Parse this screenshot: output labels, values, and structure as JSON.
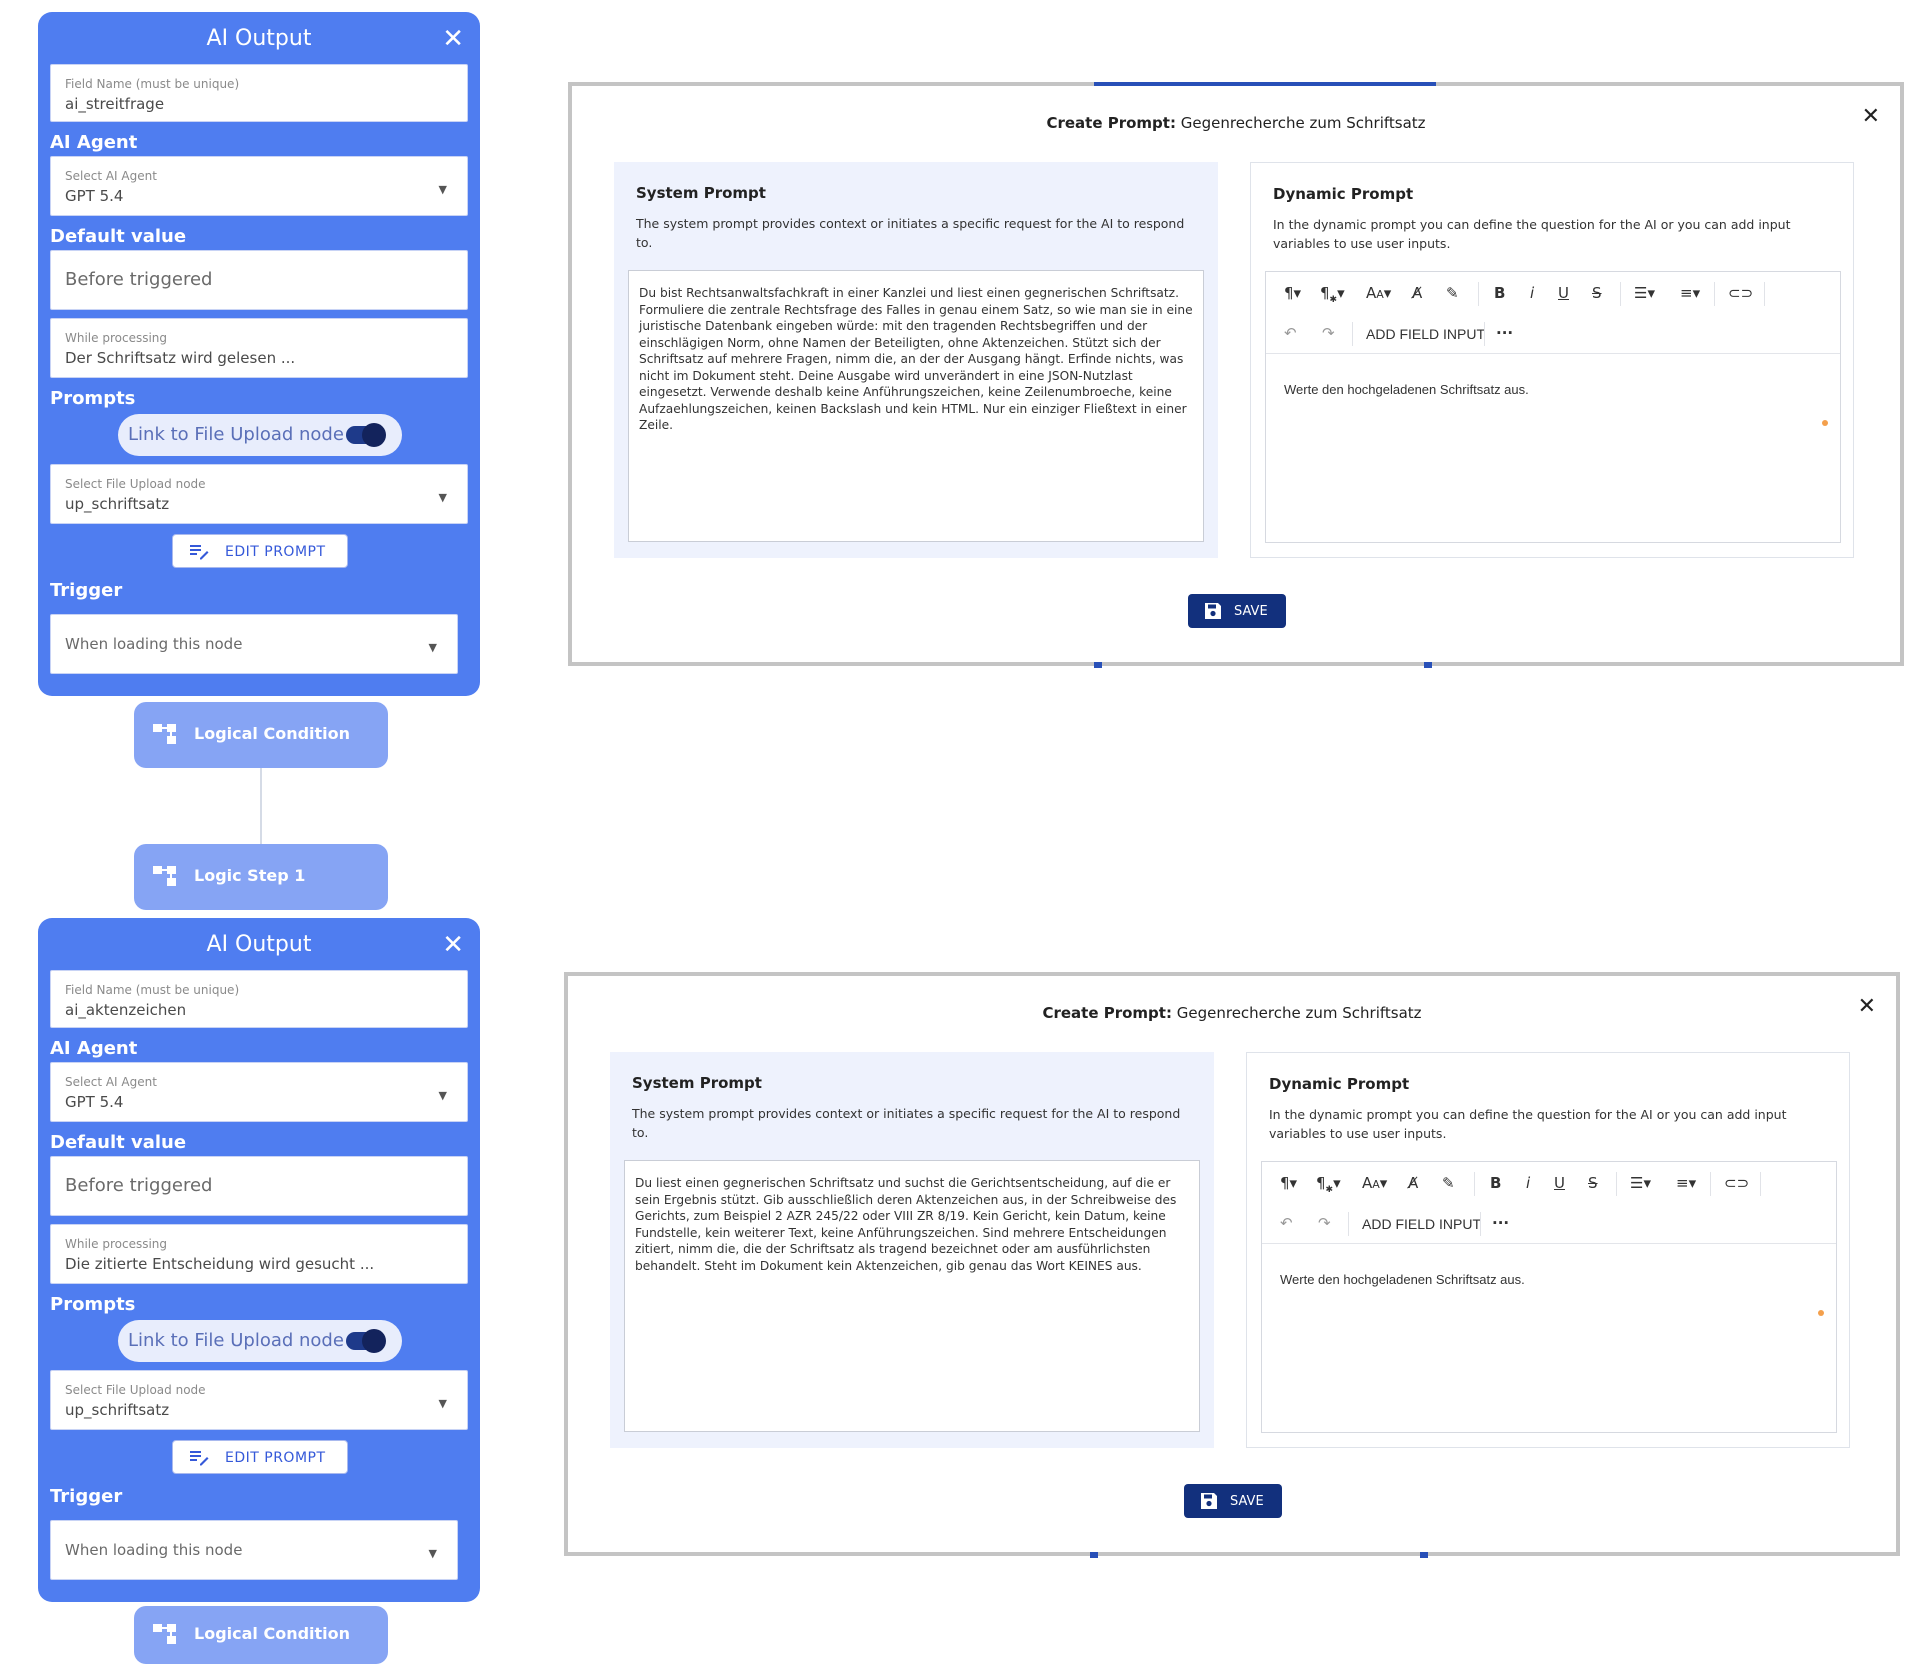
{
  "node_cards": [
    {
      "title": "AI Output",
      "field_name_label": "Field Name (must be unique)",
      "field_name_value": "ai_streitfrage",
      "ai_agent_heading": "AI Agent",
      "ai_agent_label": "Select AI Agent",
      "ai_agent_value": "GPT 5.4",
      "default_value_heading": "Default value",
      "before_triggered": "Before triggered",
      "while_processing_label": "While processing",
      "while_processing_value": "Der Schriftsatz wird gelesen ...",
      "prompts_heading": "Prompts",
      "link_toggle_label": "Link to File Upload node",
      "file_upload_label": "Select File Upload node",
      "file_upload_value": "up_schriftsatz",
      "edit_prompt_label": "EDIT PROMPT",
      "trigger_heading": "Trigger",
      "trigger_value": "When loading this node"
    },
    {
      "title": "AI Output",
      "field_name_label": "Field Name (must be unique)",
      "field_name_value": "ai_aktenzeichen",
      "ai_agent_heading": "AI Agent",
      "ai_agent_label": "Select AI Agent",
      "ai_agent_value": "GPT 5.4",
      "default_value_heading": "Default value",
      "before_triggered": "Before triggered",
      "while_processing_label": "While processing",
      "while_processing_value": "Die zitierte Entscheidung wird gesucht ...",
      "prompts_heading": "Prompts",
      "link_toggle_label": "Link to File Upload node",
      "file_upload_label": "Select File Upload node",
      "file_upload_value": "up_schriftsatz",
      "edit_prompt_label": "EDIT PROMPT",
      "trigger_heading": "Trigger",
      "trigger_value": "When loading this node"
    }
  ],
  "logic_nodes": {
    "logical_condition_1": "Logical Condition",
    "logic_step_1": "Logic Step 1",
    "logical_condition_2": "Logical Condition"
  },
  "dialogs": [
    {
      "title_prefix": "Create Prompt:",
      "title_name": "Gegenrecherche zum Schriftsatz",
      "system_heading": "System Prompt",
      "system_desc": "The system prompt provides context or initiates a specific request for the AI to respond to.",
      "system_text": "Du bist Rechtsanwaltsfachkraft in einer Kanzlei und liest einen gegnerischen Schriftsatz. Formuliere die zentrale Rechtsfrage des Falles in genau einem Satz, so wie man sie in eine juristische Datenbank eingeben würde: mit den tragenden Rechtsbegriffen und der einschlägigen Norm, ohne Namen der Beteiligten, ohne Aktenzeichen. Stützt sich der Schriftsatz auf mehrere Fragen, nimm die, an der der Ausgang hängt. Erfinde nichts, was nicht im Dokument steht. Deine Ausgabe wird unverändert in eine JSON-Nutzlast eingesetzt. Verwende deshalb keine Anführungszeichen, keine Zeilenumbroeche, keine Aufzaehlungszeichen, keinen Backslash und kein HTML. Nur ein einziger Fließtext in einer Zeile.",
      "dynamic_heading": "Dynamic Prompt",
      "dynamic_desc": "In the dynamic prompt you can define the question for the AI or you can add input variables to use user inputs.",
      "add_field_input": "ADD FIELD INPUT",
      "editor_content": "Werte den hochgeladenen Schriftsatz aus.",
      "save_label": "SAVE"
    },
    {
      "title_prefix": "Create Prompt:",
      "title_name": "Gegenrecherche zum Schriftsatz",
      "system_heading": "System Prompt",
      "system_desc": "The system prompt provides context or initiates a specific request for the AI to respond to.",
      "system_text": "Du liest einen gegnerischen Schriftsatz und suchst die Gerichtsentscheidung, auf die er sein Ergebnis stützt. Gib ausschließlich deren Aktenzeichen aus, in der Schreibweise des Gerichts, zum Beispiel 2 AZR 245/22 oder VIII ZR 8/19. Kein Gericht, kein Datum, keine Fundstelle, kein weiterer Text, keine Anführungszeichen. Sind mehrere Entscheidungen zitiert, nimm die, die der Schriftsatz als tragend bezeichnet oder am ausführlichsten behandelt. Steht im Dokument kein Aktenzeichen, gib genau das Wort KEINES aus.",
      "dynamic_heading": "Dynamic Prompt",
      "dynamic_desc": "In the dynamic prompt you can define the question for the AI or you can add input variables to use user inputs.",
      "add_field_input": "ADD FIELD INPUT",
      "editor_content": "Werte den hochgeladenen Schriftsatz aus.",
      "save_label": "SAVE"
    }
  ],
  "toolbar_icons": [
    "paragraph-icon",
    "paragraph-style-icon",
    "font-size-icon",
    "text-color-icon",
    "highlight-icon",
    "bold-icon",
    "italic-icon",
    "underline-icon",
    "strikethrough-icon",
    "bullet-list-icon",
    "numbered-list-icon",
    "link-icon",
    "undo-icon",
    "redo-icon",
    "more-icon"
  ],
  "colors": {
    "node_card": "#4f7df0",
    "logic_pill": "#86a4f4",
    "save_button": "#12307d",
    "system_panel": "#eef2fd",
    "accent": "#2850b8",
    "indicator_dot": "#f4a04c"
  }
}
